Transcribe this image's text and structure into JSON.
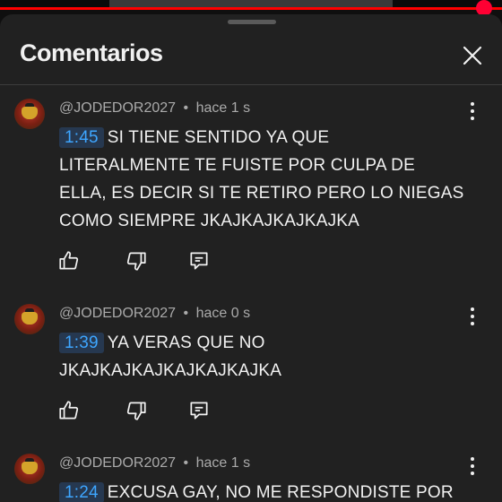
{
  "panel": {
    "title": "Comentarios"
  },
  "comments": [
    {
      "author": "@JODEDOR2027",
      "separator": "•",
      "time": "hace 1 s",
      "timestamp": "1:45",
      "text": "SI TIENE SENTIDO YA QUE\nLITERALMENTE TE FUISTE POR CULPA DE\nELLA, ES DECIR SI TE RETIRO PERO LO NIEGAS\nCOMO SIEMPRE JKAJKAJKAJKAJKA"
    },
    {
      "author": "@JODEDOR2027",
      "separator": "•",
      "time": "hace 0 s",
      "timestamp": "1:39",
      "text": "YA VERAS QUE NO\nJKAJKAJKAJKAJKAJKAJKA"
    },
    {
      "author": "@JODEDOR2027",
      "separator": "•",
      "time": "hace 1 s",
      "timestamp": "1:24",
      "text": "EXCUSA GAY, NO ME RESPONDISTE POR"
    }
  ],
  "icons": {
    "close": "close-icon",
    "more": "more-vert-icon",
    "like": "thumb-up-icon",
    "dislike": "thumb-down-icon",
    "reply": "reply-icon"
  },
  "colors": {
    "background": "#212121",
    "timestamp_link": "#3ea6ff",
    "progress": "#ff0000"
  }
}
